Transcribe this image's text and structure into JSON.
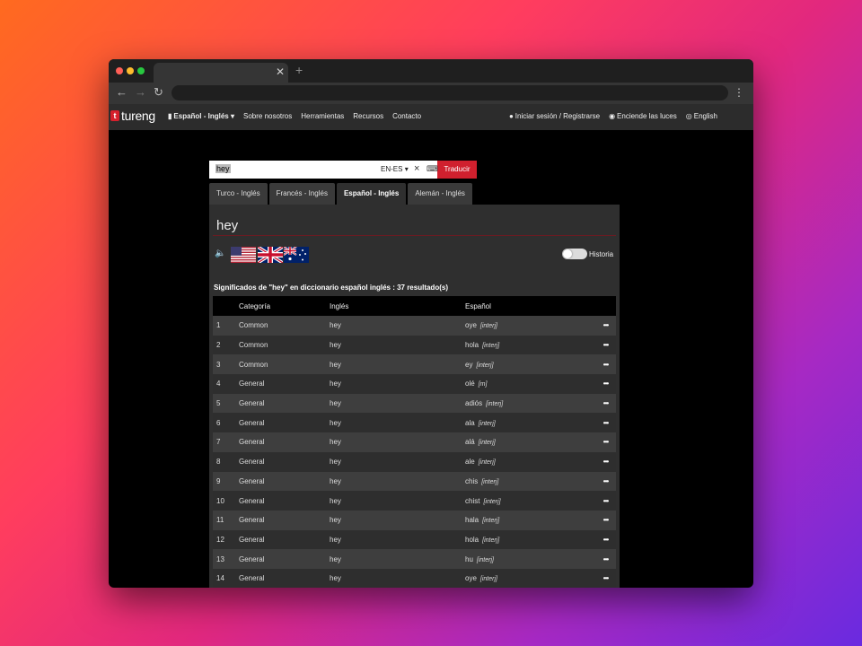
{
  "browser": {
    "tab_title": "",
    "tab_close": "✕",
    "new_tab": "+",
    "url": ""
  },
  "site": {
    "logo_mark": "t",
    "logo_text": "tureng",
    "dictionary_menu": "Español - Inglés",
    "nav": [
      "Sobre nosotros",
      "Herramientas",
      "Recursos",
      "Contacto"
    ],
    "login": "Iniciar sesión / Registrarse",
    "lights": "Enciende las luces",
    "language": "English"
  },
  "search": {
    "value": "hey",
    "lang_pair": "EN-ES",
    "button": "Traducir"
  },
  "dictionary_tabs": [
    "Turco - Inglés",
    "Francés - Inglés",
    "Español - Inglés",
    "Alemán - Inglés"
  ],
  "active_tab_index": 2,
  "panel": {
    "word": "hey",
    "history_label": "Historia",
    "history_on": false,
    "result_heading": "Significados de \"hey\" en diccionario español inglés : 37 resultado(s)"
  },
  "table": {
    "headers": [
      "",
      "Categoría",
      "Inglés",
      "Español",
      ""
    ],
    "rows": [
      {
        "n": "1",
        "cat": "Common",
        "en": "hey",
        "es": "oye",
        "tag": "[interj]"
      },
      {
        "n": "2",
        "cat": "Common",
        "en": "hey",
        "es": "hola",
        "tag": "[interj]"
      },
      {
        "n": "3",
        "cat": "Common",
        "en": "hey",
        "es": "ey",
        "tag": "[interj]"
      },
      {
        "n": "4",
        "cat": "General",
        "en": "hey",
        "es": "olé",
        "tag": "[m]"
      },
      {
        "n": "5",
        "cat": "General",
        "en": "hey",
        "es": "adiós",
        "tag": "[interj]"
      },
      {
        "n": "6",
        "cat": "General",
        "en": "hey",
        "es": "ala",
        "tag": "[interj]"
      },
      {
        "n": "7",
        "cat": "General",
        "en": "hey",
        "es": "alá",
        "tag": "[interj]"
      },
      {
        "n": "8",
        "cat": "General",
        "en": "hey",
        "es": "ale",
        "tag": "[interj]"
      },
      {
        "n": "9",
        "cat": "General",
        "en": "hey",
        "es": "chis",
        "tag": "[interj]"
      },
      {
        "n": "10",
        "cat": "General",
        "en": "hey",
        "es": "chist",
        "tag": "[interj]"
      },
      {
        "n": "11",
        "cat": "General",
        "en": "hey",
        "es": "hala",
        "tag": "[interj]"
      },
      {
        "n": "12",
        "cat": "General",
        "en": "hey",
        "es": "hola",
        "tag": "[interj]"
      },
      {
        "n": "13",
        "cat": "General",
        "en": "hey",
        "es": "hu",
        "tag": "[interj]"
      },
      {
        "n": "14",
        "cat": "General",
        "en": "hey",
        "es": "oye",
        "tag": "[interj]"
      }
    ],
    "row_menu": "•••"
  },
  "colors": {
    "accent": "#d0202e",
    "page_bg": "#000000",
    "panel_bg": "#2f2f2f",
    "nav_bg": "#2c2c2c"
  }
}
